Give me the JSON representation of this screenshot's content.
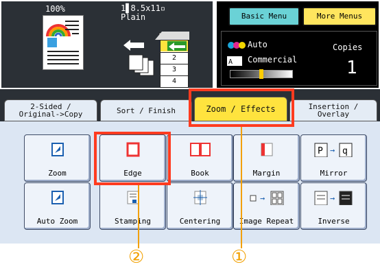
{
  "status": {
    "zoom": "100%",
    "paper_line1": "1▋8.5x11▫",
    "paper_line2": "Plain",
    "trays": [
      "1",
      "2",
      "3",
      "4"
    ]
  },
  "header": {
    "basic_menu": "Basic Menu",
    "more_menus": "More Menus"
  },
  "info": {
    "color_mode": "Auto",
    "quality": "Commercial",
    "copies_label": "Copies",
    "copies_value": "1"
  },
  "tabs": [
    {
      "label": "2-Sided /\nOriginal->Copy"
    },
    {
      "label": "Sort / Finish"
    },
    {
      "label": "Zoom / Effects",
      "active": true
    },
    {
      "label": "Insertion /\nOverlay"
    }
  ],
  "functions": [
    {
      "label": "Zoom",
      "icon": "zoom-icon"
    },
    {
      "label": "Edge",
      "icon": "edge-icon"
    },
    {
      "label": "Book",
      "icon": "book-icon"
    },
    {
      "label": "Margin",
      "icon": "margin-icon"
    },
    {
      "label": "Mirror",
      "icon": "mirror-icon"
    },
    {
      "label": "Auto Zoom",
      "icon": "auto-zoom-icon"
    },
    {
      "label": "Stamping",
      "icon": "stamping-icon"
    },
    {
      "label": "Centering",
      "icon": "centering-icon"
    },
    {
      "label": "Image Repeat",
      "icon": "image-repeat-icon"
    },
    {
      "label": "Inverse",
      "icon": "inverse-icon"
    }
  ],
  "callouts": [
    "②",
    "①"
  ],
  "colors": {
    "highlight": "#ff3b1f",
    "callout": "#f2a000",
    "active_tab": "#ffe33e"
  }
}
